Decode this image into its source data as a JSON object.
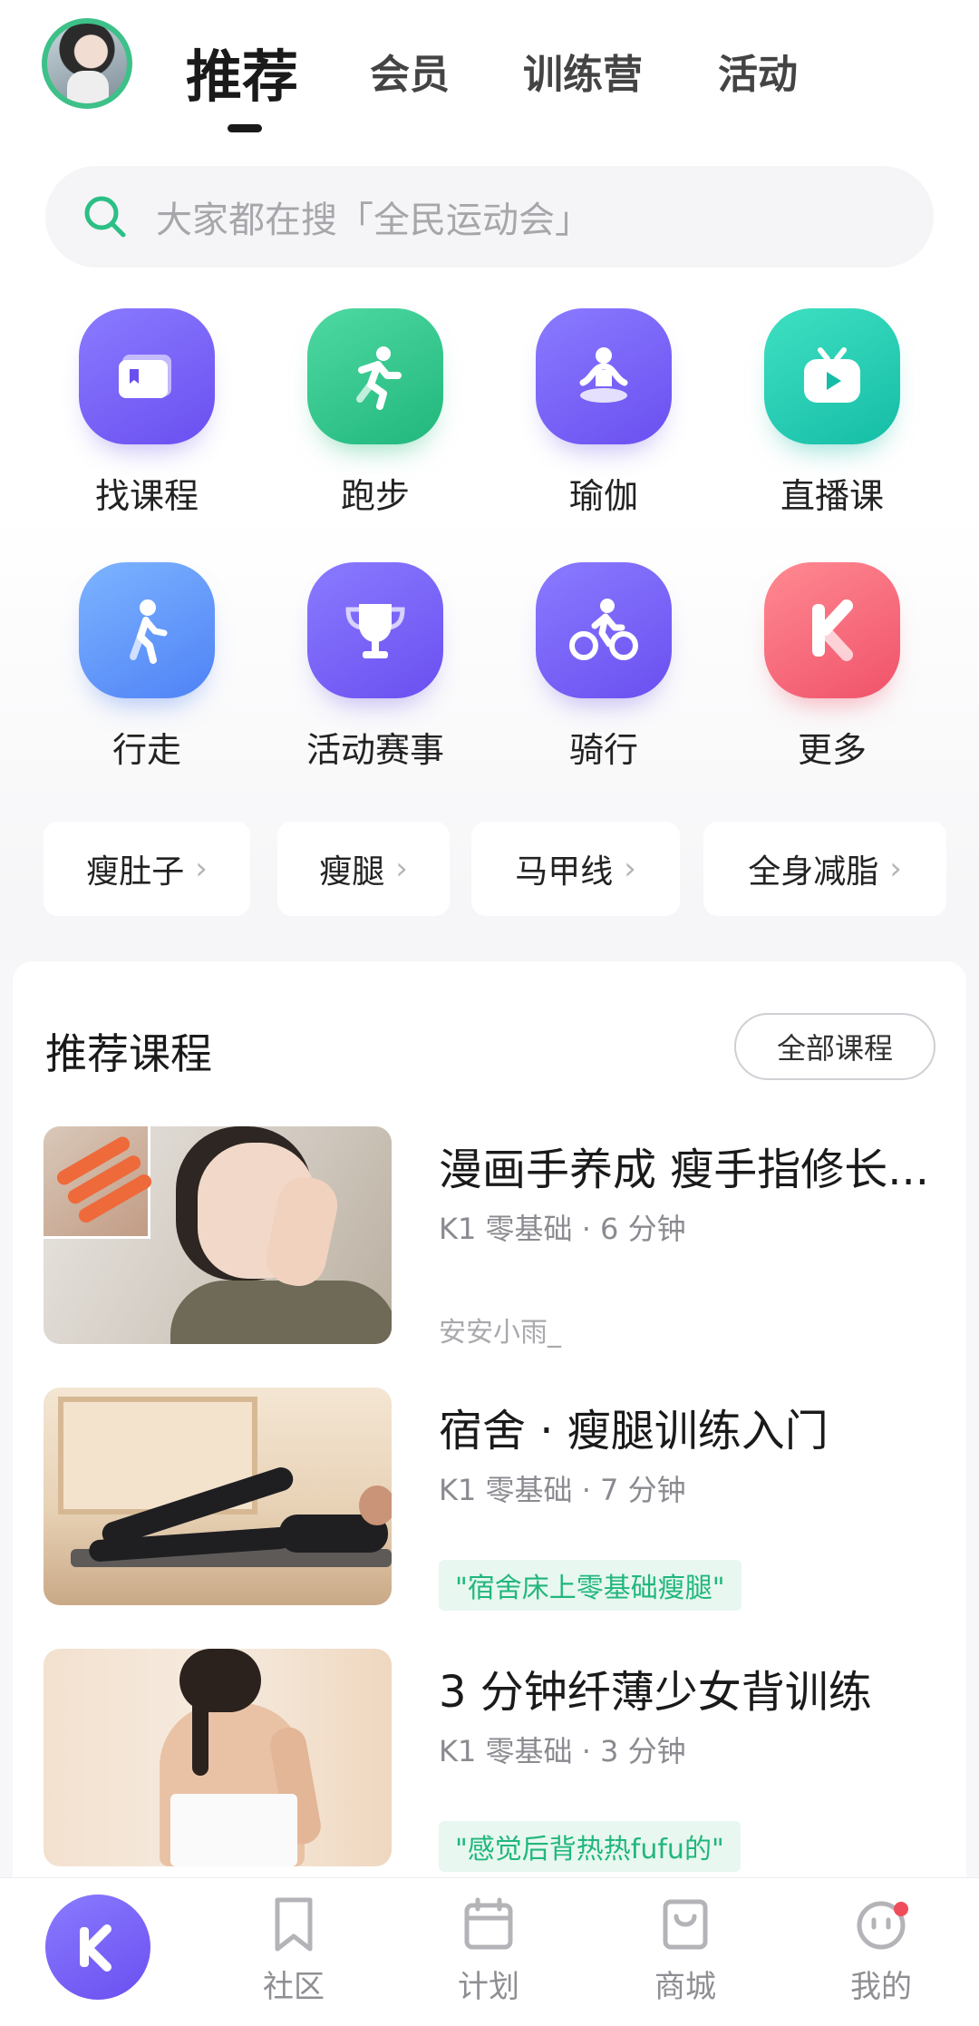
{
  "header": {
    "tabs": [
      {
        "label": "推荐",
        "active": true
      },
      {
        "label": "会员"
      },
      {
        "label": "训练营"
      },
      {
        "label": "活动"
      }
    ]
  },
  "search": {
    "placeholder": "大家都在搜「全民运动会」",
    "icon": "search-icon"
  },
  "categories": [
    {
      "label": "找课程",
      "icon": "course-card-icon",
      "color": "#6a4ff0"
    },
    {
      "label": "跑步",
      "icon": "running-icon",
      "color": "#21b77c"
    },
    {
      "label": "瑜伽",
      "icon": "yoga-icon",
      "color": "#6a4ff0"
    },
    {
      "label": "直播课",
      "icon": "live-tv-icon",
      "color": "#15bda6"
    },
    {
      "label": "行走",
      "icon": "walking-icon",
      "color": "#4f82f6"
    },
    {
      "label": "活动赛事",
      "icon": "trophy-icon",
      "color": "#6a4ff0"
    },
    {
      "label": "骑行",
      "icon": "cycling-icon",
      "color": "#6a4ff0"
    },
    {
      "label": "更多",
      "icon": "keep-logo-icon",
      "color": "#f0526a"
    }
  ],
  "chips": [
    "瘦肚子",
    "瘦腿",
    "马甲线",
    "全身减脂"
  ],
  "recommended": {
    "title": "推荐课程",
    "all_button": "全部课程",
    "courses": [
      {
        "title": "漫画手养成 瘦手指修长...",
        "meta": "K1 零基础 · 6 分钟",
        "author": "安安小雨_"
      },
      {
        "title": "宿舍 · 瘦腿训练入门",
        "meta": "K1 零基础 · 7 分钟",
        "tag": "\"宿舍床上零基础瘦腿\""
      },
      {
        "title": "3 分钟纤薄少女背训练",
        "meta": "K1 零基础 · 3 分钟",
        "tag": "\"感觉后背热热fufu的\""
      }
    ]
  },
  "bottom_nav": {
    "items": [
      {
        "label": "",
        "icon": "keep-logo-icon",
        "active": true
      },
      {
        "label": "社区",
        "icon": "bookmark-icon"
      },
      {
        "label": "计划",
        "icon": "calendar-icon"
      },
      {
        "label": "商城",
        "icon": "shopping-bag-icon"
      },
      {
        "label": "我的",
        "icon": "profile-face-icon",
        "badge": true
      }
    ]
  },
  "colors": {
    "accent": "#6a4ff0",
    "green": "#21b77c",
    "badge": "#f04d5a"
  }
}
